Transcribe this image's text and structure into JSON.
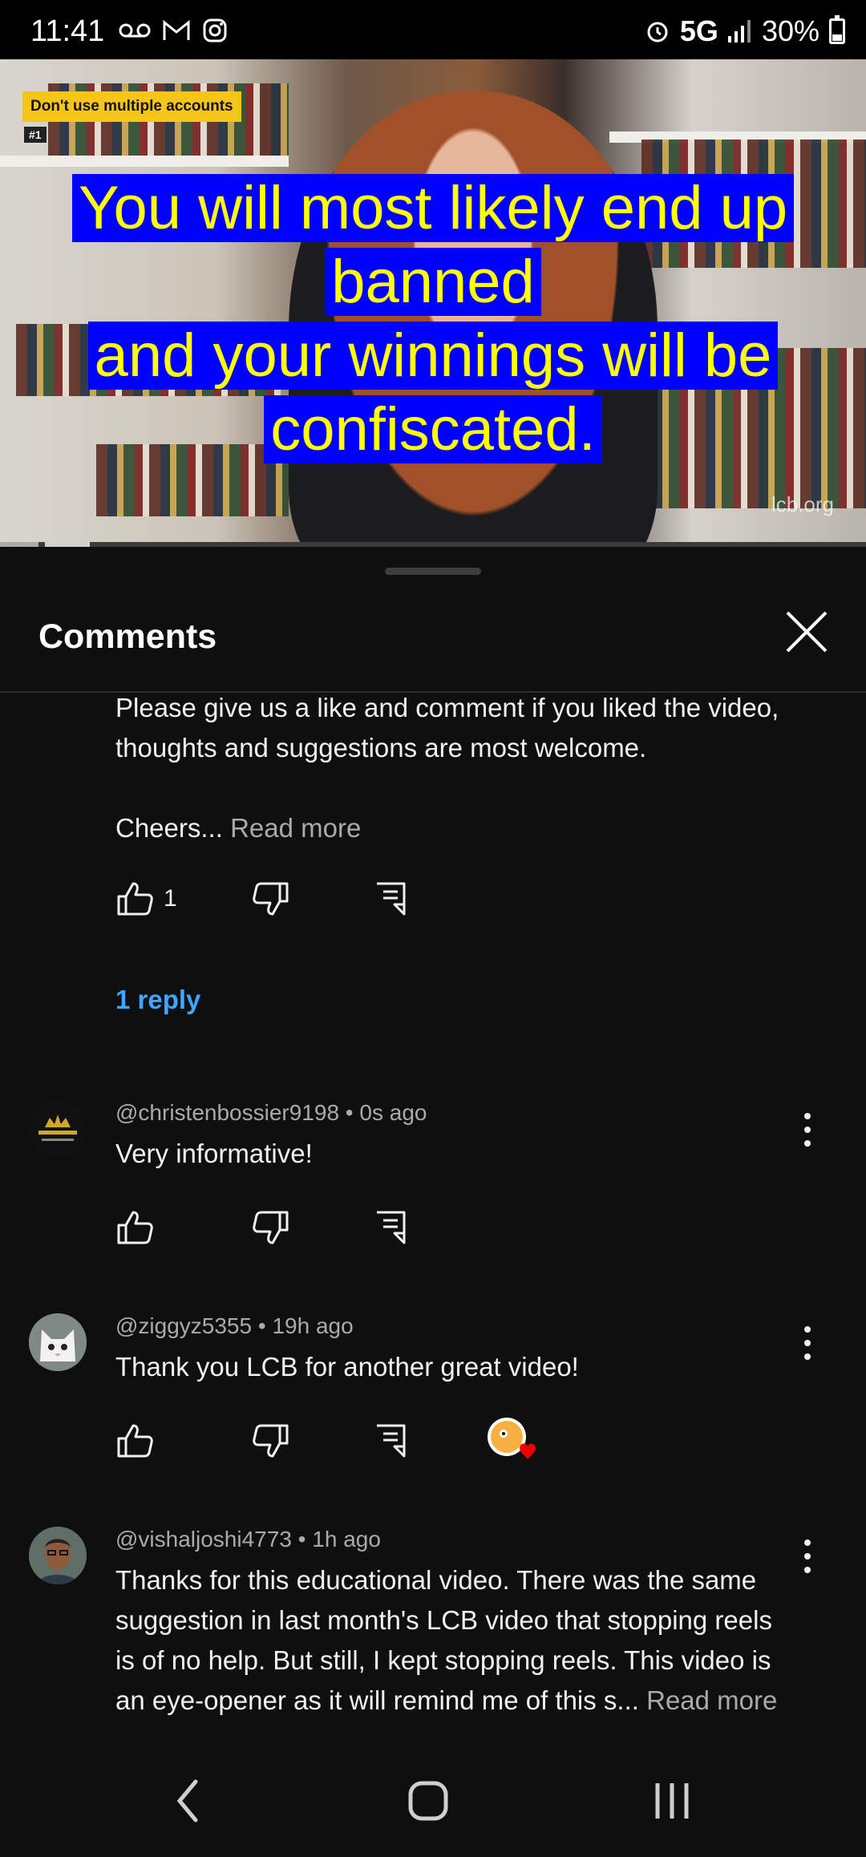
{
  "status_bar": {
    "time": "11:41",
    "network": "5G",
    "battery": "30%"
  },
  "video": {
    "tag_label": "Don't use multiple accounts",
    "tag_number": "#1",
    "caption_lines": [
      "You will most likely end up",
      "banned",
      "and your winnings will be",
      "confiscated."
    ],
    "watermark": "lcb.org"
  },
  "comments_panel": {
    "title": "Comments",
    "pinned_comment": {
      "line1": "Please give us a like and comment if you liked the video,",
      "line2": "thoughts and suggestions are most welcome.",
      "line3": "Cheers...",
      "read_more": "Read more",
      "likes": "1",
      "replies_link": "1 reply"
    },
    "comments": [
      {
        "author": "@christenbossier9198",
        "time": "0s ago",
        "text": "Very informative!",
        "avatar_text": "AUTO TRENDS LLC"
      },
      {
        "author": "@ziggyz5355",
        "time": "19h ago",
        "text": "Thank you LCB for another great video!",
        "creator_heart": true
      },
      {
        "author": "@vishaljoshi4773",
        "time": "1h ago",
        "text_lines": [
          "Thanks for this educational video. There was the same",
          "suggestion in last month's LCB video that stopping reels",
          "is of no help. But still, I kept stopping reels. This video is",
          "an eye-opener as it will remind me of this s..."
        ],
        "read_more": "Read more"
      }
    ]
  },
  "icons": {
    "like": "thumbs-up-icon",
    "dislike": "thumbs-down-icon",
    "reply": "reply-icon",
    "more": "kebab-icon",
    "close": "close-icon"
  },
  "colors": {
    "link": "#3ea6ff",
    "caption_bg": "#0000ff",
    "caption_text": "#ffff00",
    "background": "#0f0f0f"
  }
}
